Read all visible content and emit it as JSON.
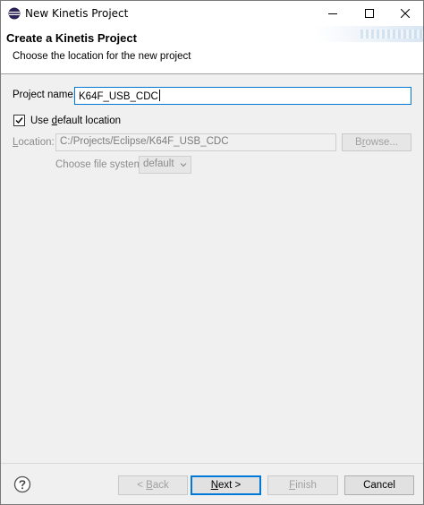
{
  "window": {
    "title": "New Kinetis Project"
  },
  "banner": {
    "heading": "Create a Kinetis Project",
    "description": "Choose the location for the new project"
  },
  "form": {
    "project_name_label": "Project name:",
    "project_name_value": "K64F_USB_CDC",
    "use_default_prefix": "Use ",
    "use_default_mnemonic": "d",
    "use_default_suffix": "efault location",
    "use_default_checked": true,
    "location_mnemonic": "L",
    "location_rest": "ocation:",
    "location_value": "C:/Projects/Eclipse/K64F_USB_CDC",
    "browse_mnemonic": "r",
    "browse_prefix": "B",
    "browse_suffix": "owse...",
    "file_system_label": "Choose file system:",
    "file_system_value": "default"
  },
  "footer": {
    "back_prefix": "< ",
    "back_mnemonic": "B",
    "back_suffix": "ack",
    "next_mnemonic": "N",
    "next_suffix": "ext >",
    "finish_mnemonic": "F",
    "finish_suffix": "inish",
    "cancel_label": "Cancel"
  },
  "icons": {
    "app": "eclipse-icon",
    "help": "help-icon",
    "minimize": "minimize-icon",
    "maximize": "maximize-icon",
    "close": "close-icon"
  },
  "colors": {
    "focus": "#0078d7",
    "disabled_text": "#8c8c8c"
  }
}
